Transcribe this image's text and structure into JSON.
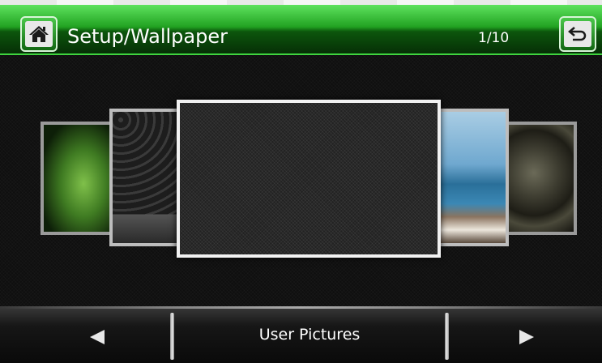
{
  "header": {
    "title": "Setup/Wallpaper",
    "page_counter": "1/10",
    "home_icon": "home-icon",
    "back_icon": "return-arrow-icon",
    "accent_color": "#22a322"
  },
  "carousel": {
    "items": [
      {
        "name": "wallpaper-leaf"
      },
      {
        "name": "wallpaper-dark-pattern"
      },
      {
        "name": "wallpaper-carbon"
      },
      {
        "name": "wallpaper-sea-boat"
      },
      {
        "name": "wallpaper-gears"
      }
    ],
    "selected_index": 2
  },
  "footer": {
    "category_label": "User Pictures",
    "prev_icon": "triangle-left-icon",
    "next_icon": "triangle-right-icon"
  }
}
